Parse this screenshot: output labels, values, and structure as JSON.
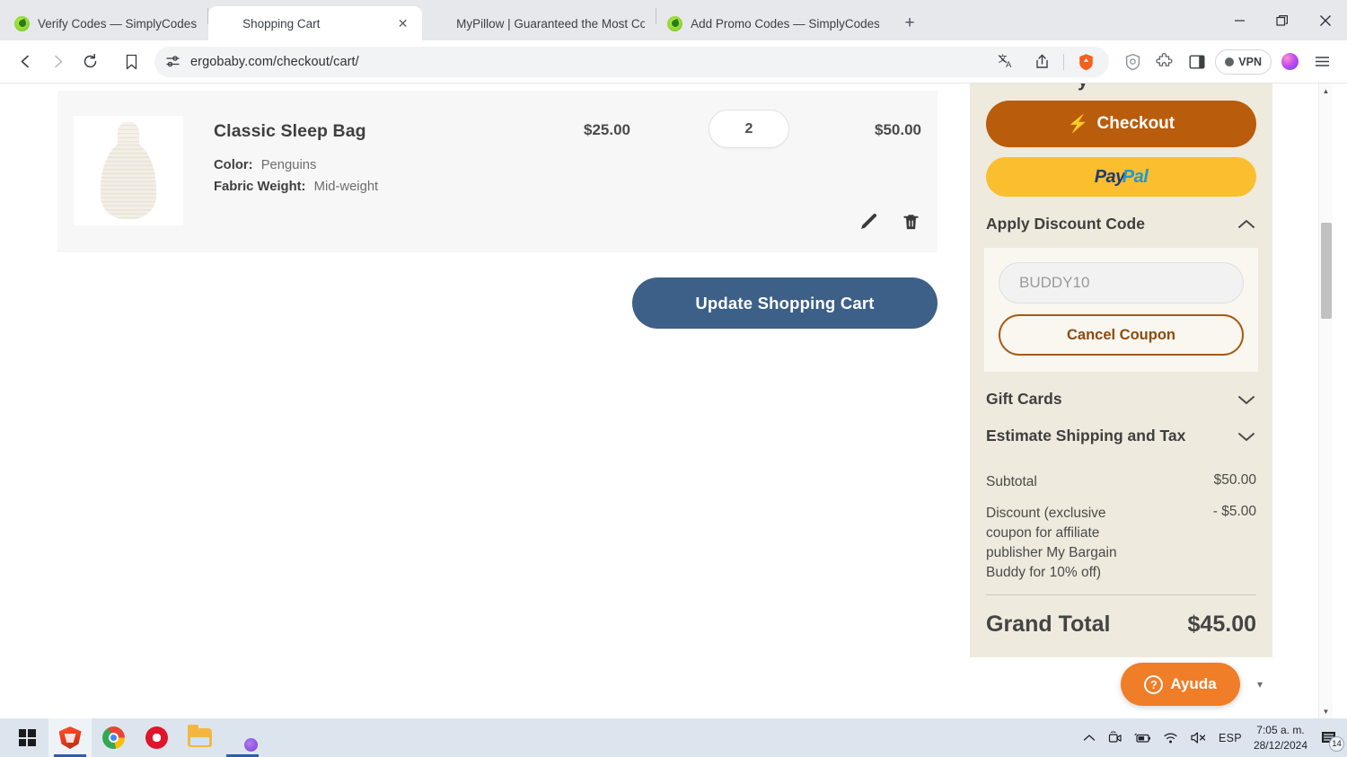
{
  "browser": {
    "tabs": [
      {
        "title": "Verify Codes — SimplyCodes",
        "favicon": "simplycodes-icon",
        "active": false
      },
      {
        "title": "Shopping Cart",
        "favicon": "ergobaby-cart-icon",
        "active": true
      },
      {
        "title": "MyPillow | Guaranteed the Most Co",
        "favicon": "mypillow-icon",
        "active": false
      },
      {
        "title": "Add Promo Codes — SimplyCodes",
        "favicon": "simplycodes-icon",
        "active": false
      }
    ],
    "new_tab_label": "+",
    "window_controls": {
      "minimize": "—",
      "maximize": "❐",
      "close": "✕"
    },
    "nav": {
      "back": "back-icon",
      "forward": "forward-icon",
      "reload": "reload-icon",
      "bookmark": "bookmark-icon",
      "site_settings": "site-settings-icon",
      "url": "ergobaby.com/checkout/cart/",
      "translate": "translate-icon",
      "share": "share-icon",
      "brave_shields": "brave-shields-icon"
    },
    "toolbar_right": {
      "shields_stats": "shield-icon",
      "extensions": "extensions-puzzle-icon",
      "sidebar_panel": "sidebar-panel-icon",
      "vpn_label": "VPN",
      "leo_ai": "leo-ai-orb-icon",
      "menu": "hamburger-menu-icon"
    }
  },
  "cart": {
    "item": {
      "name": "Classic Sleep Bag",
      "options": [
        {
          "label": "Color:",
          "value": "Penguins"
        },
        {
          "label": "Fabric Weight:",
          "value": "Mid-weight"
        }
      ],
      "price": "$25.00",
      "qty": "2",
      "subtotal": "$50.00",
      "edit_icon": "pencil-edit-icon",
      "remove_icon": "trash-delete-icon"
    },
    "update_button": "Update Shopping Cart"
  },
  "summary": {
    "clipped_heading_fragment": "y",
    "checkout_label": "Checkout",
    "checkout_icon": "lightning-bolt-icon",
    "paypal": {
      "part1": "Pay",
      "part2": "Pal"
    },
    "discount": {
      "heading": "Apply Discount Code",
      "chevron": "chevron-up-icon",
      "code_value": "BUDDY10",
      "cancel_label": "Cancel Coupon"
    },
    "gift_cards": {
      "heading": "Gift Cards",
      "chevron": "chevron-down-icon"
    },
    "shipping": {
      "heading": "Estimate Shipping and Tax",
      "chevron": "chevron-down-icon"
    },
    "totals": [
      {
        "label": "Subtotal",
        "value": "$50.00"
      },
      {
        "label": "Discount (exclusive coupon for affiliate publisher My Bargain Buddy for 10% off)",
        "value": "- $5.00"
      }
    ],
    "grand_total_label": "Grand Total",
    "grand_total_value": "$45.00"
  },
  "help_widget": {
    "label": "Ayuda",
    "icon": "question-mark-icon",
    "collapse": "▾"
  },
  "taskbar": {
    "start": "windows-start-icon",
    "apps": [
      {
        "name": "brave-browser",
        "icon": "brave-lion-icon"
      },
      {
        "name": "google-chrome",
        "icon": "chrome-icon"
      },
      {
        "name": "opera-browser",
        "icon": "opera-icon"
      },
      {
        "name": "file-explorer",
        "icon": "folder-icon"
      },
      {
        "name": "brave-simplycodes",
        "icon": "brave-simplycodes-icon"
      }
    ],
    "tray": {
      "overflow": "chevron-up-icon",
      "camera": "camera-icon",
      "battery": "battery-icon",
      "wifi": "wifi-icon",
      "volume": "volume-muted-icon",
      "language": "ESP",
      "time": "7:05 a. m.",
      "date": "28/12/2024",
      "notifications_icon": "notifications-icon",
      "notifications_count": "14"
    }
  },
  "colors": {
    "checkout_orange": "#b95c0c",
    "paypal_yellow": "#fbbe2f",
    "update_blue": "#3c6087",
    "summary_bg": "#efeade",
    "help_orange": "#f07d28"
  }
}
